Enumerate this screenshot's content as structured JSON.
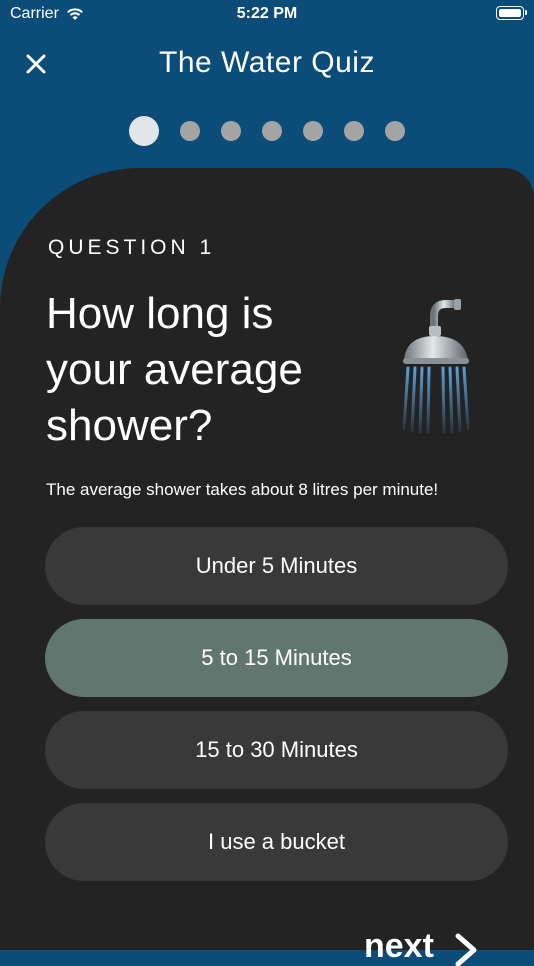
{
  "status_bar": {
    "carrier": "Carrier",
    "time": "5:22 PM"
  },
  "header": {
    "title": "The Water Quiz",
    "close_icon": "close-icon"
  },
  "progress": {
    "total_steps": 7,
    "current_step": 1
  },
  "question": {
    "label": "QUESTION 1",
    "title": "How long is your average shower?",
    "hint": "The average shower takes about 8 litres per minute!",
    "icon": "shower-head-icon"
  },
  "options": [
    {
      "label": "Under 5 Minutes",
      "selected": false
    },
    {
      "label": "5 to 15 Minutes",
      "selected": true
    },
    {
      "label": "15 to 30 Minutes",
      "selected": false
    },
    {
      "label": "I use a bucket",
      "selected": false
    }
  ],
  "footer": {
    "next_label": "next",
    "next_icon": "chevron-right-icon"
  },
  "colors": {
    "header_bg": "#0b4d78",
    "card_bg": "#232323",
    "option_bg": "#393939",
    "option_selected_bg": "#60766f",
    "dot_active": "#e3e6e9",
    "dot_inactive": "#a4a4a4"
  }
}
